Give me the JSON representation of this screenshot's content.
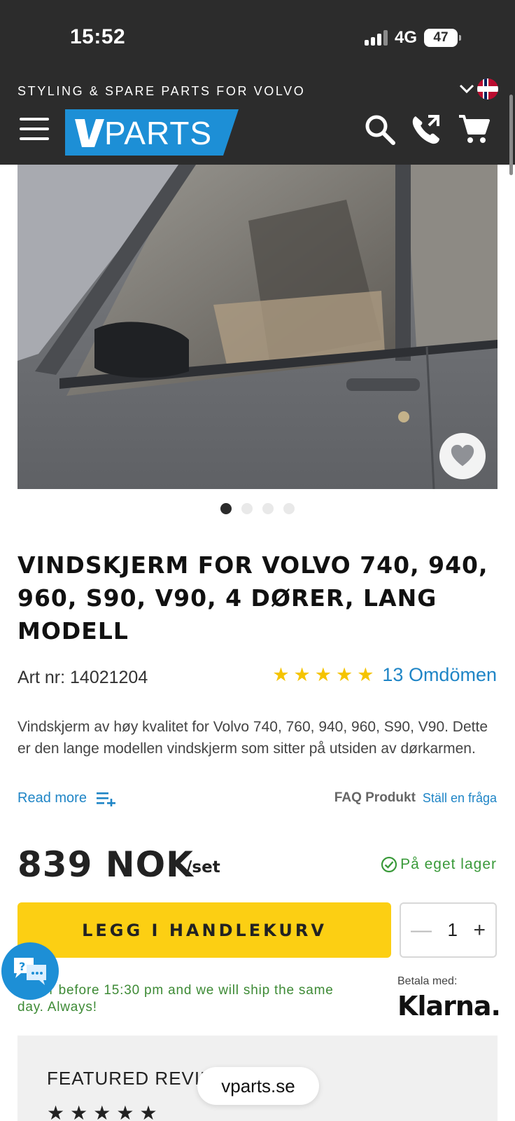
{
  "status_bar": {
    "time": "15:52",
    "network": "4G",
    "battery": "47"
  },
  "header": {
    "tagline": "STYLING & SPARE PARTS FOR VOLVO",
    "logo_text": "PARTS",
    "colors": {
      "background": "#2c2c2c",
      "logo_blue": "#1d8fd6"
    },
    "icons": [
      "menu-icon",
      "search-icon",
      "phone-icon",
      "cart-icon",
      "chevron-down-icon",
      "norway-flag-icon"
    ]
  },
  "gallery": {
    "image_count": 4,
    "active_index": 0
  },
  "product": {
    "title": "VINDSKJERM FOR VOLVO 740, 940, 960, S90, V90, 4 DØRER, LANG MODELL",
    "art_nr": "Art nr: 14021204",
    "rating_stars": 5,
    "reviews_label": "13 Omdömen",
    "description": "Vindskjerm av høy kvalitet for Volvo 740, 760, 940, 960, S90, V90. Dette er den lange modellen vindskjerm som sitter på utsiden av dørkarmen.",
    "read_more": "Read more",
    "faq_label": "FAQ Produkt",
    "faq_link": "Ställ en fråga",
    "price": "839 NOK",
    "price_unit": "/set",
    "stock": "På eget lager",
    "add_to_cart": "LEGG I HANDLEKURV",
    "quantity": "1",
    "qty_minus": "—",
    "qty_plus": "+",
    "ship_note": "Order before 15:30 pm and we will ship the same day. Always!",
    "pay_with": "Betala med:",
    "klarna": "Klarna."
  },
  "featured": {
    "title": "FEATURED REVIEWS",
    "stars": 5
  },
  "browser": {
    "url": "vparts.se"
  },
  "accent_colors": {
    "cta_yellow": "#fccf13",
    "link_blue": "#1f85c6",
    "stock_green": "#3a9a3a",
    "star_yellow": "#f5c400"
  }
}
